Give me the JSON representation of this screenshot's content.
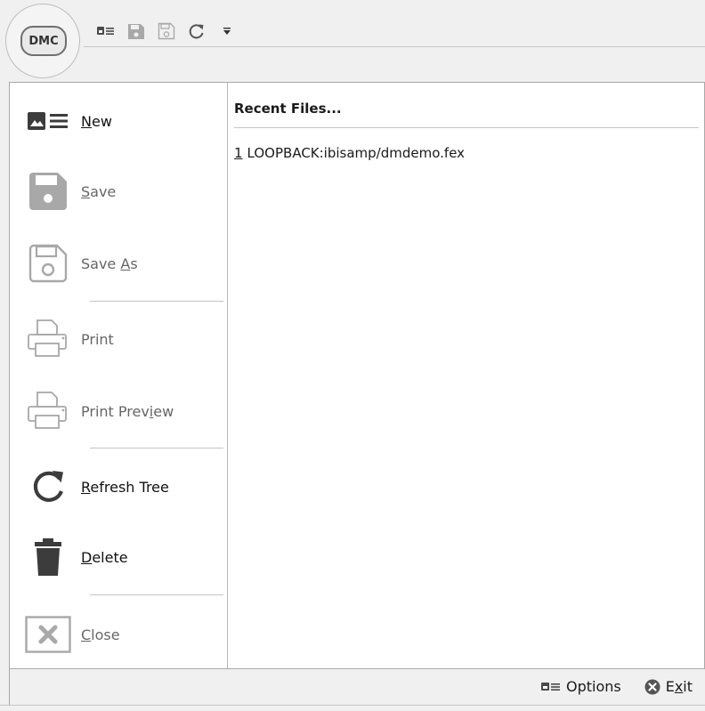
{
  "app": {
    "button_label": "DMC"
  },
  "quick_access": {
    "items": [
      {
        "icon": "options-icon"
      },
      {
        "icon": "save-icon"
      },
      {
        "icon": "save-as-icon"
      },
      {
        "icon": "refresh-icon"
      },
      {
        "icon": "customize-dropdown-icon"
      }
    ]
  },
  "menu": {
    "new": {
      "mnemonic": "N",
      "rest": "ew",
      "enabled": true
    },
    "save": {
      "mnemonic": "S",
      "rest": "ave",
      "enabled": false
    },
    "save_as": {
      "before": "Save ",
      "mnemonic": "A",
      "rest": "s",
      "enabled": false
    },
    "print": {
      "label": "Print",
      "enabled": false
    },
    "print_preview": {
      "before": "Print Prev",
      "mnemonic": "i",
      "rest": "ew",
      "enabled": false
    },
    "refresh_tree": {
      "mnemonic": "R",
      "rest": "efresh Tree",
      "enabled": true
    },
    "delete": {
      "mnemonic": "D",
      "rest": "elete",
      "enabled": true
    },
    "close": {
      "mnemonic": "C",
      "rest": "lose",
      "enabled": false
    }
  },
  "recent": {
    "title": "Recent Files...",
    "files": [
      {
        "number": "1",
        "path": "LOOPBACK:ibisamp/dmdemo.fex"
      }
    ]
  },
  "footer": {
    "options_label": "Options",
    "exit_before": "E",
    "exit_mnemonic": "x",
    "exit_rest": "it"
  },
  "colors": {
    "icon_enabled": "#3c3c3c",
    "icon_disabled": "#a8a8a8",
    "exit_icon": "#555555"
  }
}
